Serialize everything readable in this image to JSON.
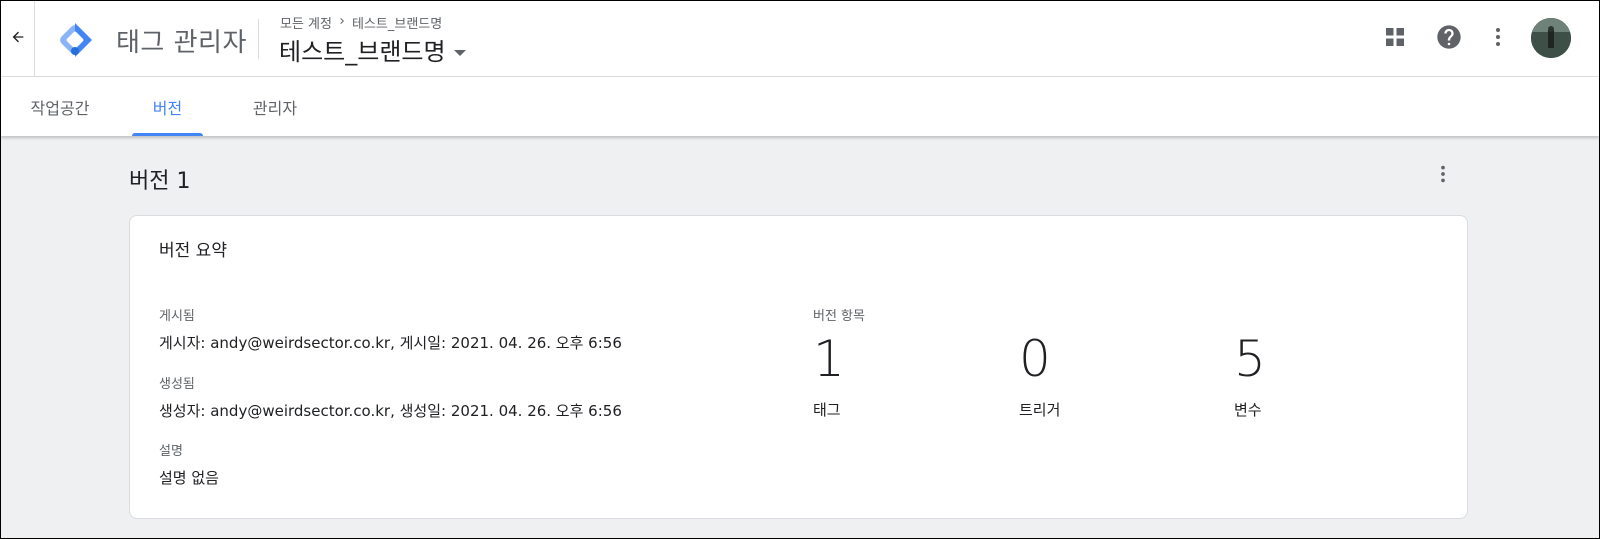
{
  "header": {
    "product_name": "태그 관리자",
    "breadcrumb": {
      "account_link": "모든 계정",
      "container": "테스트_브랜드명"
    },
    "container_name": "테스트_브랜드명"
  },
  "icons": {
    "back": "arrow-back-icon",
    "logo": "tag-manager-logo",
    "apps": "apps-grid-icon",
    "help": "help-icon",
    "more": "more-vert-icon"
  },
  "tabs": [
    {
      "label": "작업공간",
      "active": false
    },
    {
      "label": "버전",
      "active": true
    },
    {
      "label": "관리자",
      "active": false
    }
  ],
  "version": {
    "title": "버전 1",
    "summary": {
      "title": "버전 요약",
      "published_label": "게시됨",
      "published_value": "게시자: andy@weirdsector.co.kr, 게시일: 2021. 04. 26. 오후 6:56",
      "created_label": "생성됨",
      "created_value": "생성자: andy@weirdsector.co.kr, 생성일: 2021. 04. 26. 오후 6:56",
      "description_label": "설명",
      "description_value": "설명 없음",
      "items_label": "버전 항목",
      "counts": [
        {
          "value": "1",
          "label": "태그"
        },
        {
          "value": "0",
          "label": "트리거"
        },
        {
          "value": "5",
          "label": "변수"
        }
      ]
    }
  },
  "colors": {
    "accent": "#4285f4",
    "background": "#eef0f2",
    "logo_light": "#8ab4f8",
    "logo_dark": "#4285f4",
    "logo_darker": "#246fdb"
  }
}
